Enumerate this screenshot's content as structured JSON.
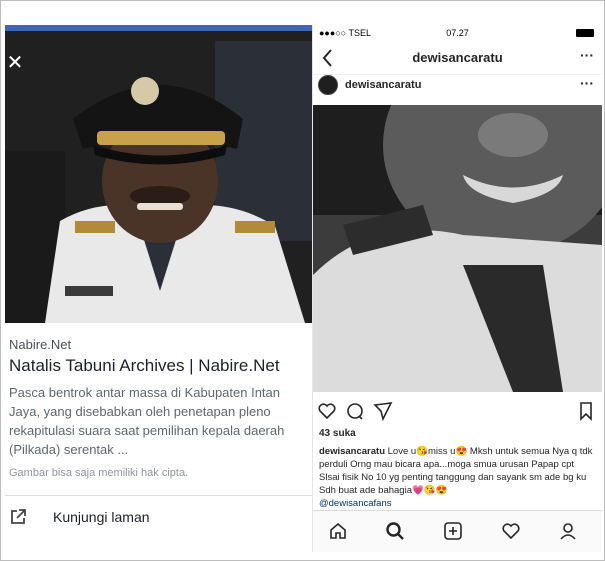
{
  "left_panel": {
    "progress": 1.0,
    "close_icon": "close-icon",
    "source": "Nabire.Net",
    "title": "Natalis Tabuni Archives | Nabire.Net",
    "description": "Pasca bentrok antar massa di Kabupaten Intan Jaya, yang disebabkan oleh penetapan pleno rekapitulasi suara saat pemilihan kepala daerah (Pilkada) serentak ...",
    "copyright_note": "Gambar bisa saja memiliki hak cipta.",
    "visit_label": "Kunjungi laman",
    "visit_icon": "external-link-icon",
    "accent_color": "#4267b2"
  },
  "right_panel": {
    "status_bar": {
      "carrier": "●●●○○ TSEL",
      "time": "07.27"
    },
    "header": {
      "username": "dewisancaratu",
      "back_icon": "chevron-left-icon",
      "more": "···"
    },
    "post": {
      "username": "dewisancaratu",
      "more": "···",
      "likes": "43 suka",
      "caption_user": "dewisancaratu",
      "caption_text": "Love u😘miss u😍 Mksh untuk semua Nya q tdk perduli Orng mau bicara apa...moga smua urusan Papap cpt Slsai fisik No 10 yg penting tanggung dan sayank sm ade bg ku Sdh buat ade bahagia💗😘😍",
      "mention": "@dewisancafans"
    },
    "actions": [
      "heart-icon",
      "comment-icon",
      "share-icon",
      "bookmark-icon"
    ],
    "tabbar": [
      "home-icon",
      "search-icon",
      "add-post-icon",
      "activity-heart-icon",
      "profile-icon"
    ]
  }
}
